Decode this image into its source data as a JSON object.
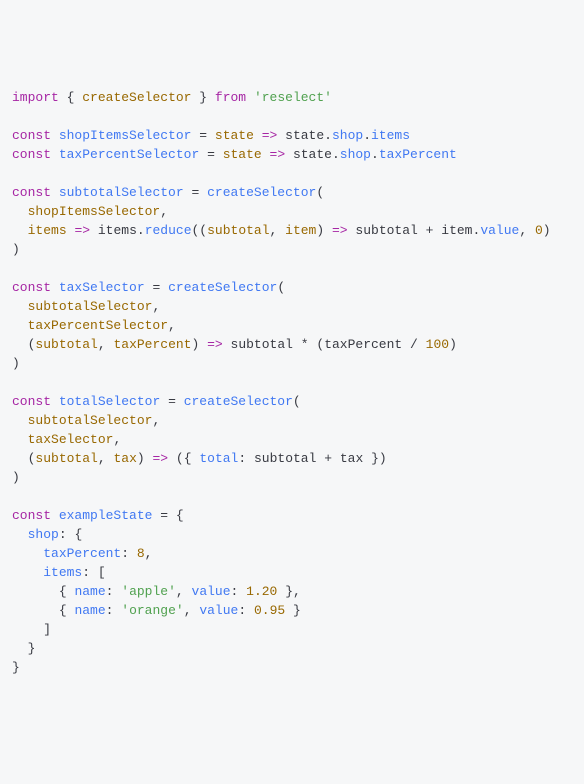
{
  "code": {
    "t1": "import",
    "t2": "{",
    "t3": "createSelector",
    "t4": "}",
    "t5": "from",
    "t6": "'reselect'",
    "t7": "const",
    "t8": "shopItemsSelector",
    "t9": "=",
    "t10": "state",
    "t11": "=>",
    "t12": "state",
    "t13": ".",
    "t14": "shop",
    "t15": ".",
    "t16": "items",
    "t17": "const",
    "t18": "taxPercentSelector",
    "t19": "=",
    "t20": "state",
    "t21": "=>",
    "t22": "state",
    "t23": ".",
    "t24": "shop",
    "t25": ".",
    "t26": "taxPercent",
    "t27": "const",
    "t28": "subtotalSelector",
    "t29": "=",
    "t30": "createSelector",
    "t31": "(",
    "t32": "shopItemsSelector",
    "t33": ",",
    "t34": "items",
    "t35": "=>",
    "t36": "items",
    "t37": ".",
    "t38": "reduce",
    "t39": "((",
    "t40": "subtotal",
    "t41": ",",
    "t42": "item",
    "t43": ")",
    "t44": "=>",
    "t45": "subtotal",
    "t46": "+",
    "t47": "item",
    "t48": ".",
    "t49": "value",
    "t50": ",",
    "t51": "0",
    "t52": ")",
    "t53": ")",
    "t54": "const",
    "t55": "taxSelector",
    "t56": "=",
    "t57": "createSelector",
    "t58": "(",
    "t59": "subtotalSelector",
    "t60": ",",
    "t61": "taxPercentSelector",
    "t62": ",",
    "t63": "(",
    "t64": "subtotal",
    "t65": ",",
    "t66": "taxPercent",
    "t67": ")",
    "t68": "=>",
    "t69": "subtotal",
    "t70": "*",
    "t71": "(",
    "t72": "taxPercent",
    "t73": "/",
    "t74": "100",
    "t75": ")",
    "t76": ")",
    "t77": "const",
    "t78": "totalSelector",
    "t79": "=",
    "t80": "createSelector",
    "t81": "(",
    "t82": "subtotalSelector",
    "t83": ",",
    "t84": "taxSelector",
    "t85": ",",
    "t86": "(",
    "t87": "subtotal",
    "t88": ",",
    "t89": "tax",
    "t90": ")",
    "t91": "=>",
    "t92": "({",
    "t93": "total",
    "t94": ":",
    "t95": "subtotal",
    "t96": "+",
    "t97": "tax",
    "t98": "})",
    "t99": ")",
    "t100": "const",
    "t101": "exampleState",
    "t102": "=",
    "t103": "{",
    "t104": "shop",
    "t105": ":",
    "t106": "{",
    "t107": "taxPercent",
    "t108": ":",
    "t109": "8",
    "t110": ",",
    "t111": "items",
    "t112": ":",
    "t113": "[",
    "t114": "{",
    "t115": "name",
    "t116": ":",
    "t117": "'apple'",
    "t118": ",",
    "t119": "value",
    "t120": ":",
    "t121": "1.20",
    "t122": "},",
    "t123": "{",
    "t124": "name",
    "t125": ":",
    "t126": "'orange'",
    "t127": ",",
    "t128": "value",
    "t129": ":",
    "t130": "0.95",
    "t131": "}",
    "t132": "]",
    "t133": "}",
    "t134": "}"
  }
}
